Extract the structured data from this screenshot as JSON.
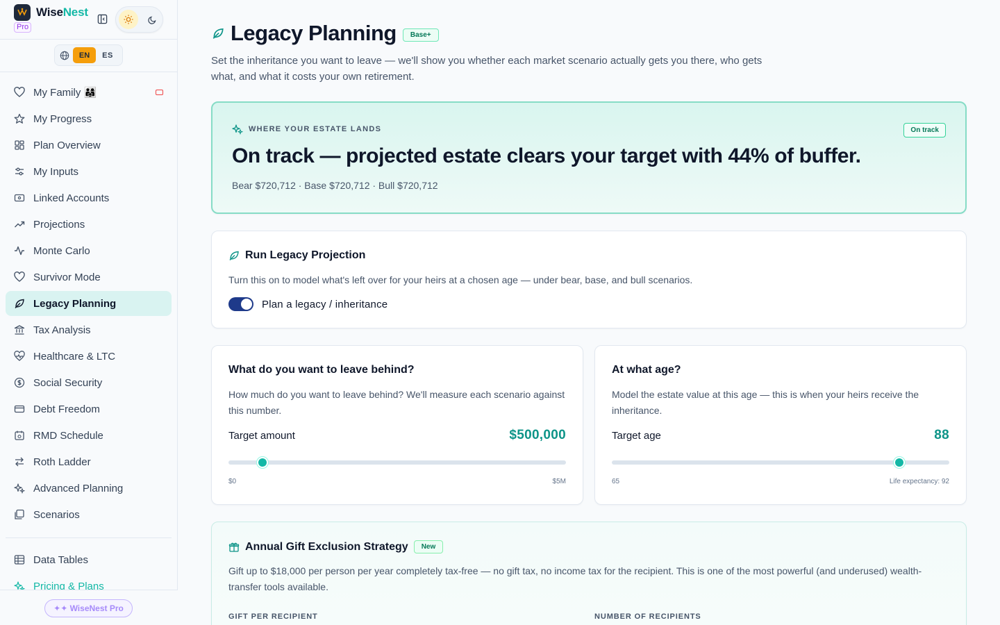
{
  "brand": {
    "name_part1": "Wise",
    "name_part2": "Nest",
    "plan_badge": "Pro"
  },
  "language": {
    "en": "EN",
    "es": "ES"
  },
  "nav": {
    "items": [
      {
        "label": "My Family 👨‍👩‍👧",
        "icon": "heart-icon"
      },
      {
        "label": "My Progress",
        "icon": "star-icon"
      },
      {
        "label": "Plan Overview",
        "icon": "grid-icon"
      },
      {
        "label": "My Inputs",
        "icon": "sliders-icon"
      },
      {
        "label": "Linked Accounts",
        "icon": "wallet-icon"
      },
      {
        "label": "Projections",
        "icon": "trending-up-icon"
      },
      {
        "label": "Monte Carlo",
        "icon": "activity-icon"
      },
      {
        "label": "Survivor Mode",
        "icon": "heart-icon"
      },
      {
        "label": "Legacy Planning",
        "icon": "leaf-icon",
        "active": true
      },
      {
        "label": "Tax Analysis",
        "icon": "bank-icon"
      },
      {
        "label": "Healthcare & LTC",
        "icon": "heart-pulse-icon"
      },
      {
        "label": "Social Security",
        "icon": "dollar-circle-icon"
      },
      {
        "label": "Debt Freedom",
        "icon": "credit-card-icon"
      },
      {
        "label": "RMD Schedule",
        "icon": "calendar-icon"
      },
      {
        "label": "Roth Ladder",
        "icon": "swap-icon"
      },
      {
        "label": "Advanced Planning",
        "icon": "sparkles-icon"
      },
      {
        "label": "Scenarios",
        "icon": "layers-icon"
      }
    ],
    "secondary": [
      {
        "label": "Data Tables",
        "icon": "table-icon"
      },
      {
        "label": "Pricing & Plans",
        "icon": "sparkles-icon"
      }
    ],
    "upgrade_label": "✦✦ WiseNest Pro"
  },
  "page": {
    "title": "Legacy Planning",
    "tier_badge": "Base+",
    "description": "Set the inheritance you want to leave — we'll show you whether each market scenario actually gets you there, who gets what, and what it costs your own retirement."
  },
  "estate": {
    "eyebrow": "WHERE YOUR ESTATE LANDS",
    "status": "On track",
    "headline": "On track — projected estate clears your target with 44% of buffer.",
    "scenarios": "Bear  $720,712 · Base  $720,712 · Bull  $720,712"
  },
  "run": {
    "title": "Run Legacy Projection",
    "description": "Turn this on to model what's left over for your heirs at a chosen age — under bear, base, and bull scenarios.",
    "toggle_label": "Plan a legacy / inheritance",
    "toggle_on": true
  },
  "target_amount": {
    "title": "What do you want to leave behind?",
    "description": "How much do you want to leave behind? We'll measure each scenario against this number.",
    "label": "Target amount",
    "value": "$500,000",
    "min_label": "$0",
    "max_label": "$5M",
    "min": 0,
    "max": 5000000,
    "current": 500000
  },
  "target_age": {
    "title": "At what age?",
    "description": "Model the estate value at this age — this is when your heirs receive the inheritance.",
    "label": "Target age",
    "value": "88",
    "min_label": "65",
    "max_label": "Life expectancy: 92",
    "min": 65,
    "max": 92,
    "current": 88
  },
  "gift": {
    "title": "Annual Gift Exclusion Strategy",
    "badge": "New",
    "description": "Gift up to $18,000 per person per year completely tax-free — no gift tax, no income tax for the recipient. This is one of the most powerful (and underused) wealth-transfer tools available.",
    "field1_label": "GIFT PER RECIPIENT",
    "field2_label": "NUMBER OF RECIPIENTS"
  },
  "colors": {
    "accent": "#14b8a6",
    "active_nav_bg": "#d9f3f1",
    "toggle": "#1e3a8a",
    "on_track": "#047857"
  }
}
